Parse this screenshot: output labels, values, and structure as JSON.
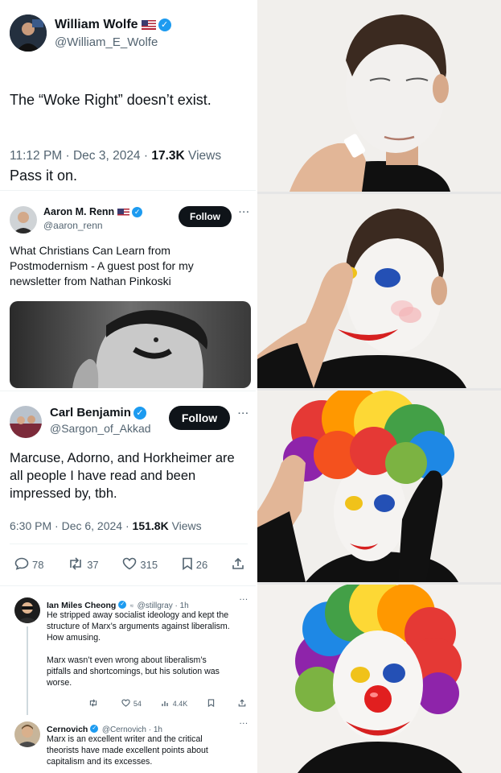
{
  "tweet1": {
    "name": "William Wolfe",
    "handle": "@William_E_Wolfe",
    "lines": [
      "The “Woke Right” doesn’t exist.",
      "",
      "Pass it on."
    ],
    "time": "11:12 PM · Dec 3, 2024 · ",
    "views_count": "17.3K",
    "views_label": " Views"
  },
  "tweet2": {
    "name": "Aaron M. Renn",
    "handle": "@aaron_renn",
    "follow_label": "Follow",
    "more": "···",
    "text": "What Christians Can Learn from\nPostmodernism - A guest post for my\nnewsletter from Nathan Pinkoski"
  },
  "tweet3": {
    "name": "Carl Benjamin",
    "handle": "@Sargon_of_Akkad",
    "follow_label": "Follow",
    "more": "···",
    "text": "Marcuse, Adorno, and Horkheimer are\nall people I have read and been\nimpressed by, tbh.",
    "time": "6:30 PM · Dec 6, 2024 · ",
    "views_count": "151.8K",
    "views_label": " Views",
    "replies": "78",
    "reposts": "37",
    "likes": "315",
    "bookmarks": "26"
  },
  "reply1": {
    "name": "Ian Miles Cheong",
    "handle": "@stillgray · 1h",
    "text": "He stripped away socialist ideology and kept the\nstructure of Marx’s arguments against liberalism.\nHow amusing.\n\nMarx wasn’t even wrong about liberalism’s\npitfalls and shortcomings, but his solution was\nworse.",
    "likes": "54",
    "views": "4.4K"
  },
  "reply2": {
    "name": "Cernovich",
    "handle": "@Cernovich · 1h",
    "text": "Marx is an excellent writer and the critical\ntheorists have made excellent points about\ncapitalism and its excesses."
  },
  "colors": {
    "accent_blue": "#1d9bf0",
    "text_dark": "#0f1419",
    "text_muted": "#536471"
  }
}
